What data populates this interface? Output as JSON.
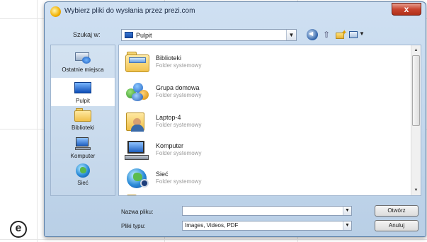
{
  "dialog": {
    "title": "Wybierz pliki do wysłania przez prezi.com",
    "close_label": "x",
    "look_in_label": "Szukaj w:",
    "look_in_value": "Pulpit"
  },
  "places": [
    {
      "label": "Ostatnie miejsca",
      "icon": "recent-places-icon"
    },
    {
      "label": "Pulpit",
      "icon": "desktop-icon"
    },
    {
      "label": "Biblioteki",
      "icon": "libraries-icon"
    },
    {
      "label": "Komputer",
      "icon": "computer-icon"
    },
    {
      "label": "Sieć",
      "icon": "network-icon"
    }
  ],
  "files": [
    {
      "name": "Biblioteki",
      "type": "Folder systemowy",
      "icon": "libraries-folder-icon"
    },
    {
      "name": "Grupa domowa",
      "type": "Folder systemowy",
      "icon": "homegroup-icon"
    },
    {
      "name": "Laptop-4",
      "type": "Folder systemowy",
      "icon": "user-folder-icon"
    },
    {
      "name": "Komputer",
      "type": "Folder systemowy",
      "icon": "computer-icon"
    },
    {
      "name": "Sieć",
      "type": "Folder systemowy",
      "icon": "network-icon"
    }
  ],
  "bottom": {
    "filename_label": "Nazwa pliku:",
    "filename_value": "",
    "filetype_label": "Pliki typu:",
    "filetype_value": "Images, Videos, PDF",
    "open_label": "Otwórz",
    "cancel_label": "Anuluj"
  },
  "colors": {
    "window_frame": "#b9cfe6",
    "close_button": "#c8452f",
    "places_pane": "#c3d6ea"
  }
}
